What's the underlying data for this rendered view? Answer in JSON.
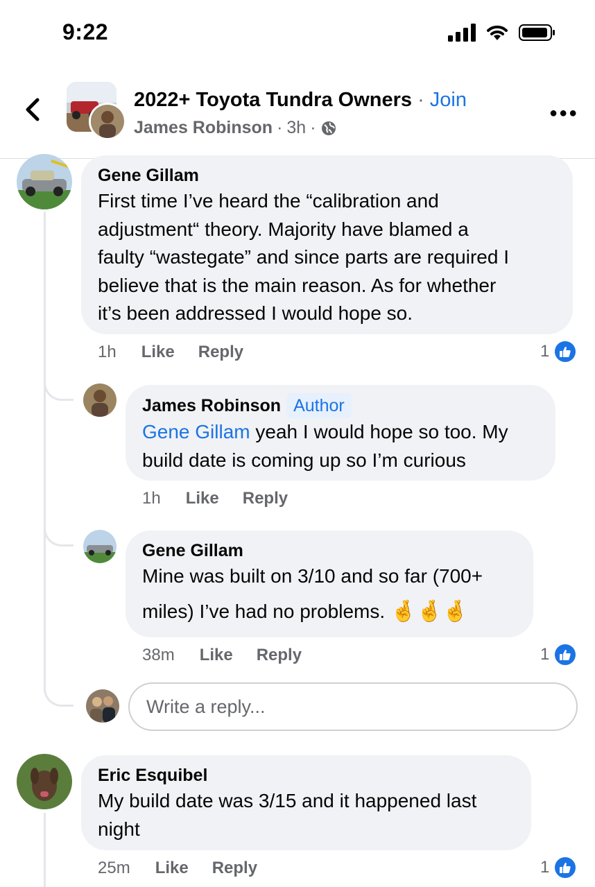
{
  "status_bar": {
    "time": "9:22"
  },
  "header": {
    "group_name": "2022+ Toyota Tundra Owners",
    "separator": " · ",
    "join_label": "Join",
    "author": "James Robinson",
    "meta_dot": "·",
    "time_ago": "3h",
    "meta_dot2": "·"
  },
  "comments": [
    {
      "name": "Gene Gillam",
      "lines": [
        "First time I’ve heard the “calibration and",
        "adjustment“ theory.  Majority have blamed a",
        "faulty “wastegate” and since parts are required I",
        "believe that is the main reason.  As for whether",
        "it’s been addressed I would hope so."
      ],
      "time": "1h",
      "like": "Like",
      "reply": "Reply",
      "reaction_count": "1"
    },
    {
      "name": "James Robinson",
      "badge": "Author",
      "mention": "Gene Gillam",
      "line1_rest": " yeah I would hope so too. My",
      "line2": "build date is coming up so I’m curious",
      "time": "1h",
      "like": "Like",
      "reply": "Reply"
    },
    {
      "name": "Gene Gillam",
      "line1": "Mine was built on 3/10 and so far (700+",
      "line2": "miles) I’ve had no problems.",
      "emojis": "🤞🤞🤞",
      "time": "38m",
      "like": "Like",
      "reply": "Reply",
      "reaction_count": "1"
    },
    {
      "name": "Eric Esquibel",
      "line1": "My build date was 3/15 and it happened last",
      "line2": "night",
      "time": "25m",
      "like": "Like",
      "reply": "Reply",
      "reaction_count": "1"
    }
  ],
  "reply_box": {
    "placeholder": "Write a reply..."
  },
  "colors": {
    "accent": "#1b74e4",
    "bubble": "#f0f2f5",
    "muted": "#65676b"
  },
  "icons": [
    "back-chevron-icon",
    "signal-icon",
    "wifi-icon",
    "battery-icon",
    "globe-icon",
    "more-icon",
    "like-thumb-icon",
    "fingers-crossed-emoji"
  ]
}
